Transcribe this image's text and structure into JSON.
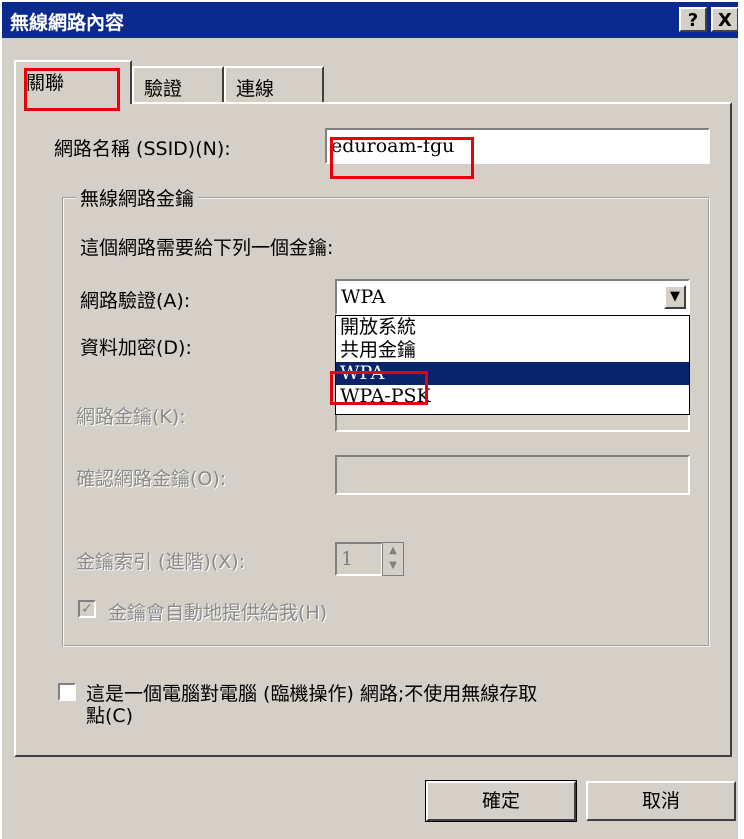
{
  "window": {
    "title": "無線網路內容",
    "help_label": "?",
    "close_label": "X"
  },
  "tabs": [
    {
      "label": "關聯"
    },
    {
      "label": "驗證"
    },
    {
      "label": "連線"
    }
  ],
  "ssid": {
    "label": "網路名稱 (SSID)(N):",
    "value": "eduroam-fgu"
  },
  "wireless_key": {
    "group_title": "無線網路金鑰",
    "description": "這個網路需要給下列一個金鑰:",
    "auth_label": "網路驗證(A):",
    "auth_value": "WPA",
    "encryption_label": "資料加密(D):",
    "dropdown_options": [
      "開放系統",
      "共用金鑰",
      "WPA",
      "WPA-PSK"
    ],
    "selected_option_index": 2,
    "network_key_label": "網路金鑰(K):",
    "confirm_key_label": "確認網路金鑰(O):",
    "key_index_label": "金鑰索引 (進階)(X):",
    "key_index_value": "1",
    "auto_key_label": "金鑰會自動地提供給我(H)",
    "auto_key_checked": true
  },
  "adhoc": {
    "label_line1": "這是一個電腦對電腦 (臨機操作) 網路;不使用無線存取",
    "label_line2": "點(C)",
    "checked": false
  },
  "buttons": {
    "ok": "確定",
    "cancel": "取消"
  },
  "colors": {
    "titlebar": "#0a2a8e",
    "selection": "#0a246a",
    "annotation": "#e8000b",
    "dialog_bg": "#d4d0c8"
  }
}
